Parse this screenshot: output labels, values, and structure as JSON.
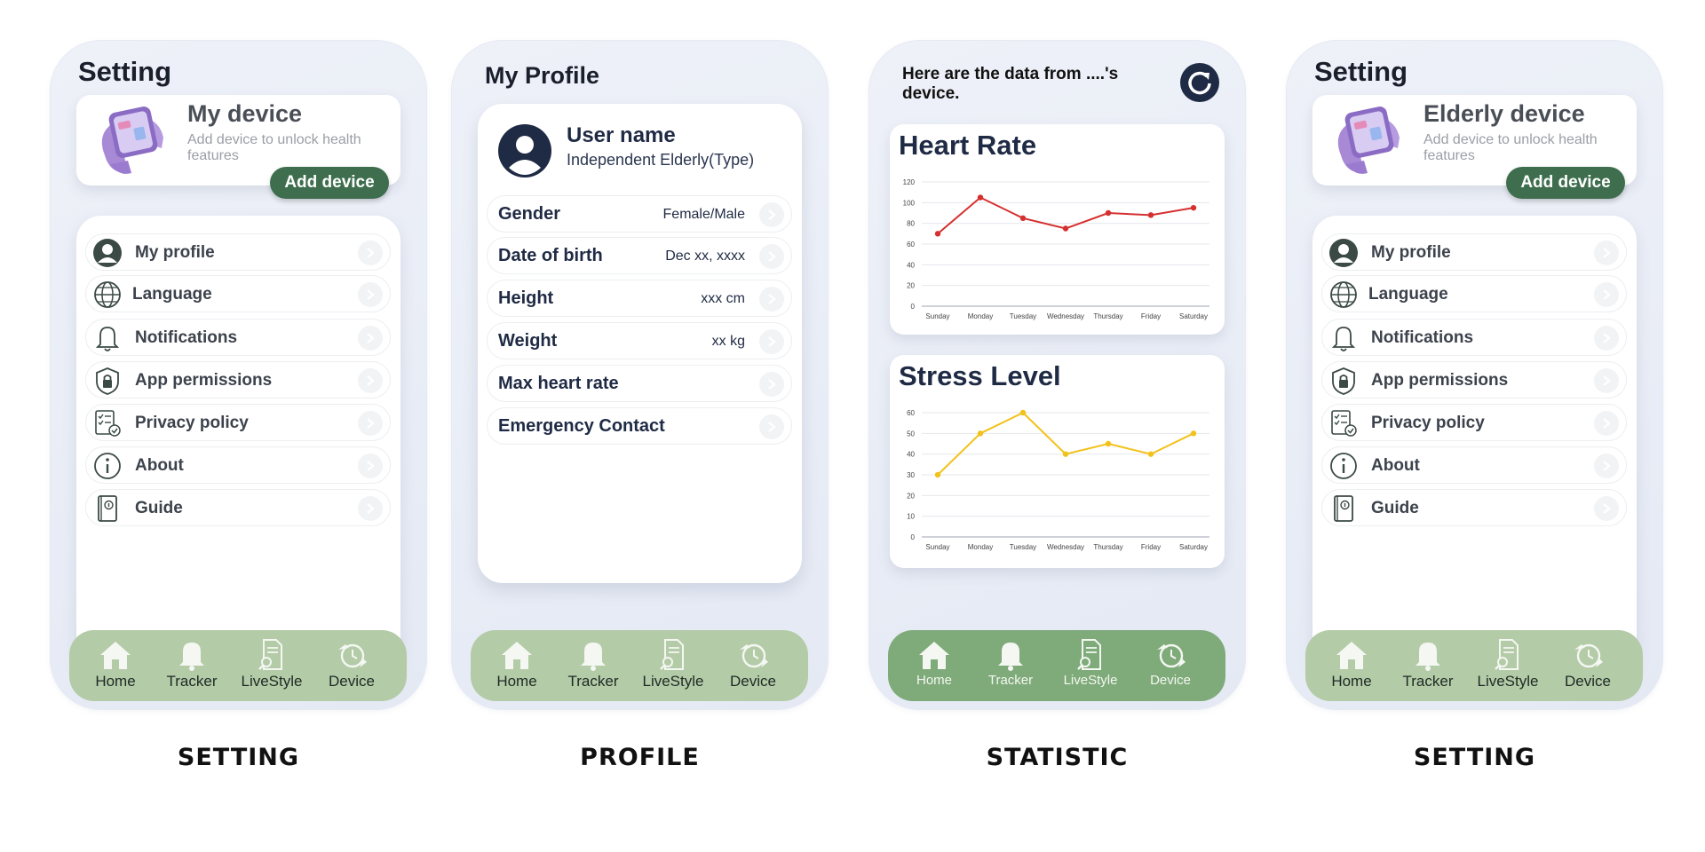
{
  "captions": [
    "SETTING",
    "PROFILE",
    "STATISTIC",
    "SETTING"
  ],
  "nav": [
    "Home",
    "Tracker",
    "LiveStyle",
    "Device"
  ],
  "setting1": {
    "title": "Setting",
    "device_name": "My device",
    "device_sub": "Add device to unlock health features",
    "add_button": "Add device",
    "menu": [
      "My profile",
      "Language",
      "Notifications",
      "App permissions",
      "Privacy policy",
      "About",
      "Guide"
    ]
  },
  "profile": {
    "title": "My Profile",
    "user_name": "User name",
    "user_type": "Independent Elderly(Type)",
    "fields": [
      {
        "label": "Gender",
        "value": "Female/Male"
      },
      {
        "label": "Date of birth",
        "value": "Dec xx, xxxx"
      },
      {
        "label": "Height",
        "value": "xxx cm"
      },
      {
        "label": "Weight",
        "value": "xx kg"
      },
      {
        "label": "Max heart rate",
        "value": ""
      },
      {
        "label": "Emergency Contact",
        "value": ""
      }
    ]
  },
  "statistic": {
    "heading": "Here are the data from ....'s device."
  },
  "setting2": {
    "title": "Setting",
    "device_name": "Elderly device",
    "device_sub": "Add device to unlock health features",
    "add_button": "Add device",
    "menu": [
      "My profile",
      "Language",
      "Notifications",
      "App permissions",
      "Privacy policy",
      "About",
      "Guide"
    ]
  },
  "chart_data": [
    {
      "type": "line",
      "title": "Heart Rate",
      "categories": [
        "Sunday",
        "Monday",
        "Tuesday",
        "Wednesday",
        "Thursday",
        "Friday",
        "Saturday"
      ],
      "values": [
        70,
        105,
        85,
        75,
        90,
        88,
        95
      ],
      "ylim": [
        0,
        120
      ],
      "yticks": [
        0,
        20,
        40,
        60,
        80,
        100,
        120
      ],
      "color": "#d62f2f",
      "grid": true
    },
    {
      "type": "line",
      "title": "Stress Level",
      "categories": [
        "Sunday",
        "Monday",
        "Tuesday",
        "Wednesday",
        "Thursday",
        "Friday",
        "Saturday"
      ],
      "values": [
        30,
        50,
        60,
        40,
        45,
        40,
        50
      ],
      "ylim": [
        0,
        60
      ],
      "yticks": [
        0,
        10,
        20,
        30,
        40,
        50,
        60
      ],
      "color": "#f2c21b",
      "grid": true
    }
  ],
  "colors": {
    "nav_bg": "#b4cba7",
    "nav_bg_active": "#7faa79",
    "add_button": "#3e6e4e",
    "navy": "#1f2a44"
  }
}
